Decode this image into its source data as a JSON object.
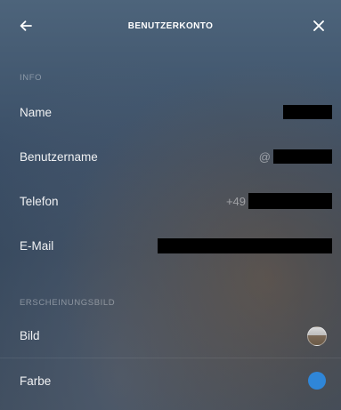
{
  "header": {
    "title": "BENUTZERKONTO",
    "back_icon": "arrow-left-icon",
    "close_icon": "close-icon"
  },
  "info": {
    "section_label": "INFO",
    "name_label": "Name",
    "username_label": "Benutzername",
    "username_prefix": "@",
    "phone_label": "Telefon",
    "phone_prefix": "+49",
    "email_label": "E-Mail"
  },
  "appearance": {
    "section_label": "ERSCHEINUNGSBILD",
    "image_label": "Bild",
    "color_label": "Farbe",
    "color_value": "#2f86d8"
  }
}
